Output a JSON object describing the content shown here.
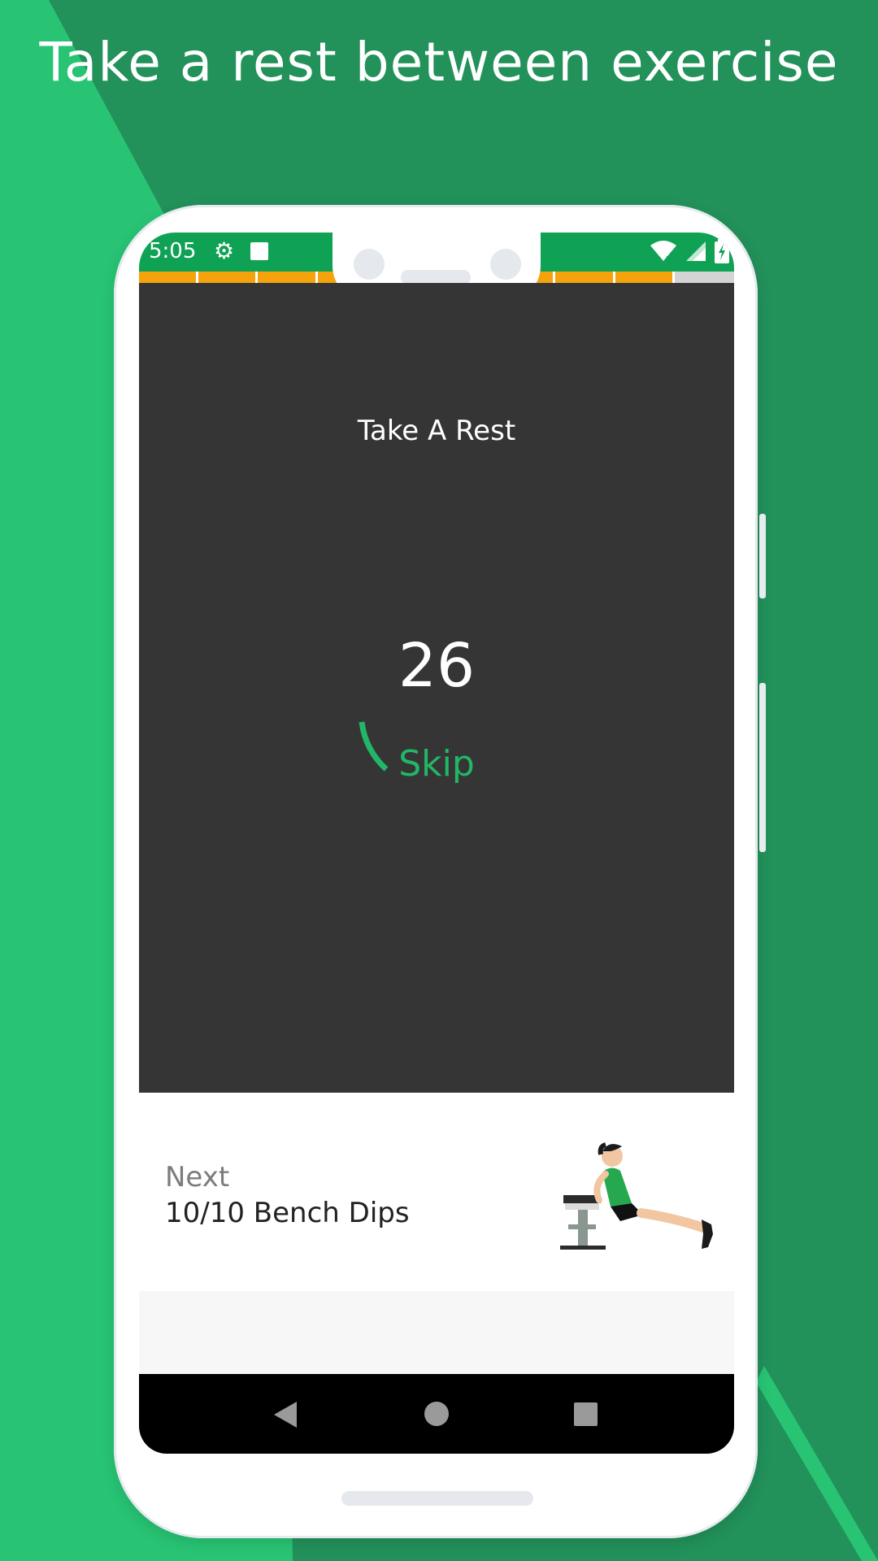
{
  "headline": "Take a rest between exercise",
  "status_bar": {
    "time": "5:05",
    "icons": [
      "gear-icon",
      "square-notification-icon",
      "wifi-icon",
      "cellular-signal-icon",
      "battery-charging-icon"
    ],
    "color": "#0fa255"
  },
  "workout_progress": {
    "completed_segments": 9,
    "total_segments": 10,
    "completed_color": "#f5a30d",
    "remaining_color": "#d4d4d4"
  },
  "rest": {
    "title": "Take A Rest",
    "countdown": "26",
    "skip_label": "Skip",
    "accent": "#22b766"
  },
  "next": {
    "label": "Next",
    "exercise": "10/10 Bench Dips",
    "illustration_icon": "bench-dips-illustration"
  },
  "nav": {
    "icons": [
      "back-icon",
      "home-icon",
      "recents-icon"
    ]
  }
}
